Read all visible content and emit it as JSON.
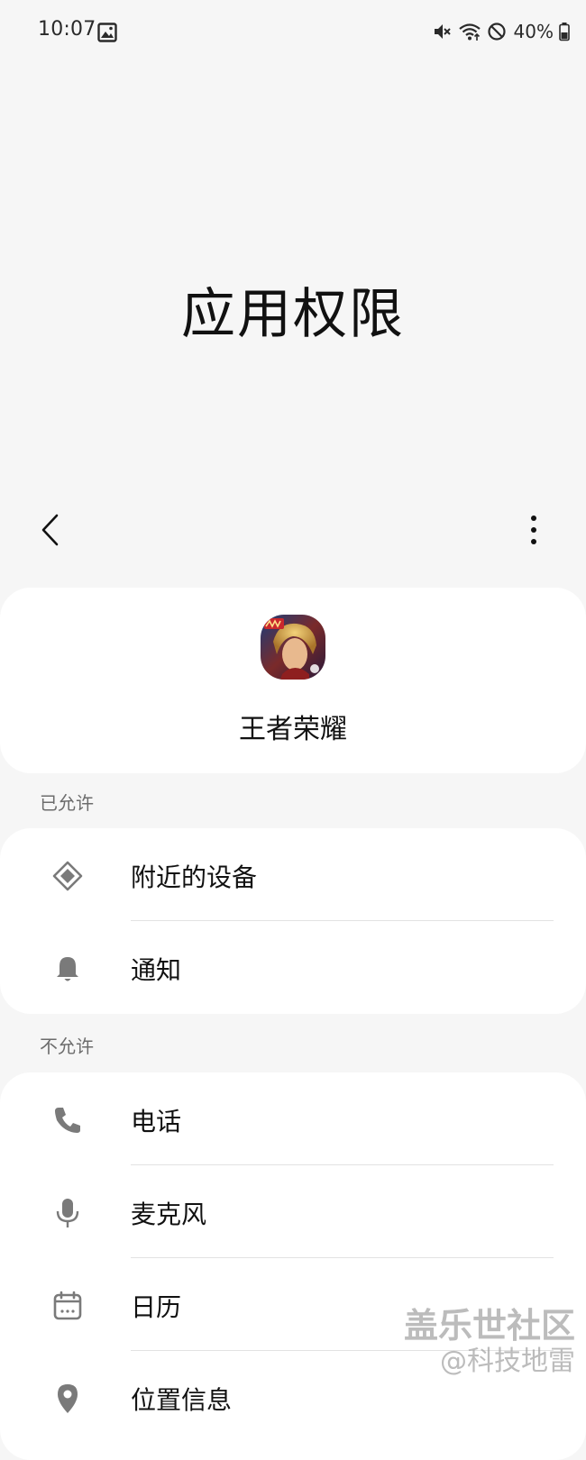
{
  "status_bar": {
    "time": "10:07",
    "battery": "40%",
    "icons": [
      "gallery-icon",
      "mute-icon",
      "wifi-icon",
      "block-icon",
      "battery-icon"
    ]
  },
  "title": "应用权限",
  "nav": {
    "back_icon": "chevron-left-icon",
    "more_icon": "more-vertical-icon"
  },
  "app": {
    "name": "王者荣耀",
    "icon": "app-icon"
  },
  "sections": {
    "allowed": {
      "label": "已允许",
      "items": [
        {
          "label": "附近的设备",
          "icon": "nearby-devices-icon"
        },
        {
          "label": "通知",
          "icon": "bell-icon"
        }
      ]
    },
    "denied": {
      "label": "不允许",
      "items": [
        {
          "label": "电话",
          "icon": "phone-icon"
        },
        {
          "label": "麦克风",
          "icon": "microphone-icon"
        },
        {
          "label": "日历",
          "icon": "calendar-icon"
        },
        {
          "label": "位置信息",
          "icon": "location-icon"
        }
      ]
    }
  },
  "watermark": {
    "line1": "盖乐世社区",
    "line2": "@科技地雷"
  },
  "colors": {
    "background": "#f6f6f6",
    "card": "#ffffff",
    "icon_gray": "#7a7a7a",
    "section_label": "#6c6c6c"
  }
}
